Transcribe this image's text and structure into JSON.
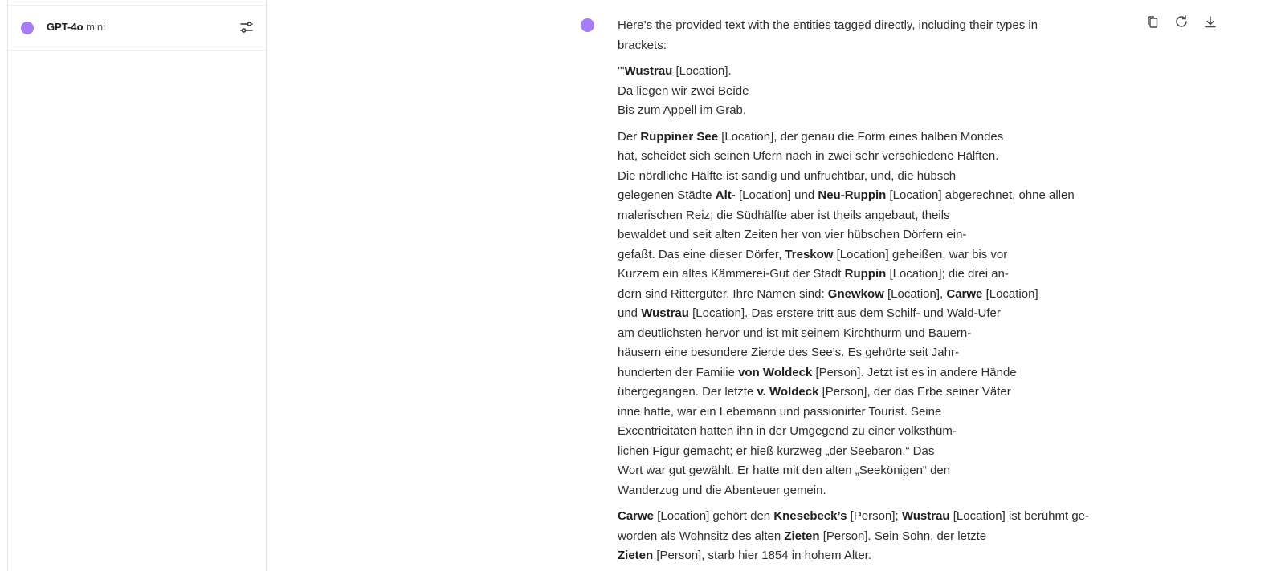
{
  "model": {
    "name": "GPT-4o",
    "variant": "mini",
    "dot_color": "#a77cf5"
  },
  "icons": {
    "settings": "sliders-icon",
    "copy": "copy-icon",
    "regenerate": "refresh-icon",
    "download": "download-icon"
  },
  "message": {
    "intro": [
      "Here’s the provided text with the entities tagged directly, including their types in",
      "brackets:"
    ],
    "p1": [
      {
        "pre": "'''",
        "entity": "Wustrau",
        "post": " [Location]."
      },
      {
        "text": "Da liegen wir zwei Beide"
      },
      {
        "text": "Bis zum Appell im Grab."
      }
    ],
    "p2_lines": [
      [
        {
          "t": "Der "
        },
        {
          "b": "Ruppiner See"
        },
        {
          "t": " [Location], der genau die Form eines halben Mondes"
        }
      ],
      [
        {
          "t": "hat, scheidet sich seinen Ufern nach in zwei sehr verschiedene Hälften."
        }
      ],
      [
        {
          "t": "Die nördliche Hälfte ist sandig und unfruchtbar, und, die hübsch"
        }
      ],
      [
        {
          "t": "gelegenen Städte "
        },
        {
          "b": "Alt-"
        },
        {
          "t": " [Location] und "
        },
        {
          "b": "Neu-Ruppin"
        },
        {
          "t": " [Location] abgerechnet, ohne allen"
        }
      ],
      [
        {
          "t": "malerischen Reiz; die Südhälfte aber ist theils angebaut, theils"
        }
      ],
      [
        {
          "t": "bewaldet und seit alten Zeiten her von vier hübschen Dörfern ein-"
        }
      ],
      [
        {
          "t": "gefaßt. Das eine dieser Dörfer, "
        },
        {
          "b": "Treskow"
        },
        {
          "t": " [Location] geheißen, war bis vor"
        }
      ],
      [
        {
          "t": "Kurzem ein altes Kämmerei-Gut der Stadt "
        },
        {
          "b": "Ruppin"
        },
        {
          "t": " [Location]; die drei an-"
        }
      ],
      [
        {
          "t": "dern sind Rittergüter. Ihre Namen sind: "
        },
        {
          "b": "Gnewkow"
        },
        {
          "t": " [Location], "
        },
        {
          "b": "Carwe"
        },
        {
          "t": " [Location]"
        }
      ],
      [
        {
          "t": "und "
        },
        {
          "b": "Wustrau"
        },
        {
          "t": " [Location]. Das erstere tritt aus dem Schilf- und Wald-Ufer"
        }
      ],
      [
        {
          "t": "am deutlichsten hervor und ist mit seinem Kirchthurm und Bauern-"
        }
      ],
      [
        {
          "t": "häusern eine besondere Zierde des See’s. Es gehörte seit Jahr-"
        }
      ],
      [
        {
          "t": "hunderten der Familie "
        },
        {
          "b": "von Woldeck"
        },
        {
          "t": " [Person]. Jetzt ist es in andere Hände"
        }
      ],
      [
        {
          "t": "übergegangen. Der letzte "
        },
        {
          "b": "v. Woldeck"
        },
        {
          "t": " [Person], der das Erbe seiner Väter"
        }
      ],
      [
        {
          "t": "inne hatte, war ein Lebemann und passionirter Tourist. Seine"
        }
      ],
      [
        {
          "t": "Excentricitäten hatten ihn in der Umgegend zu einer volksthüm-"
        }
      ],
      [
        {
          "t": "lichen Figur gemacht; er hieß kurzweg „der Seebaron.“ Das"
        }
      ],
      [
        {
          "t": "Wort war gut gewählt. Er hatte mit den alten „Seekönigen“ den"
        }
      ],
      [
        {
          "t": "Wanderzug und die Abenteuer gemein."
        }
      ]
    ],
    "p3_lines": [
      [
        {
          "b": "Carwe"
        },
        {
          "t": " [Location] gehört den "
        },
        {
          "b": "Knesebeck’s"
        },
        {
          "t": " [Person]; "
        },
        {
          "b": "Wustrau"
        },
        {
          "t": " [Location] ist berühmt ge-"
        }
      ],
      [
        {
          "t": "worden als Wohnsitz des alten "
        },
        {
          "b": "Zieten"
        },
        {
          "t": " [Person]. Sein Sohn, der letzte"
        }
      ],
      [
        {
          "b": "Zieten"
        },
        {
          "t": " [Person], starb hier 1854 in hohem Alter."
        }
      ]
    ]
  }
}
